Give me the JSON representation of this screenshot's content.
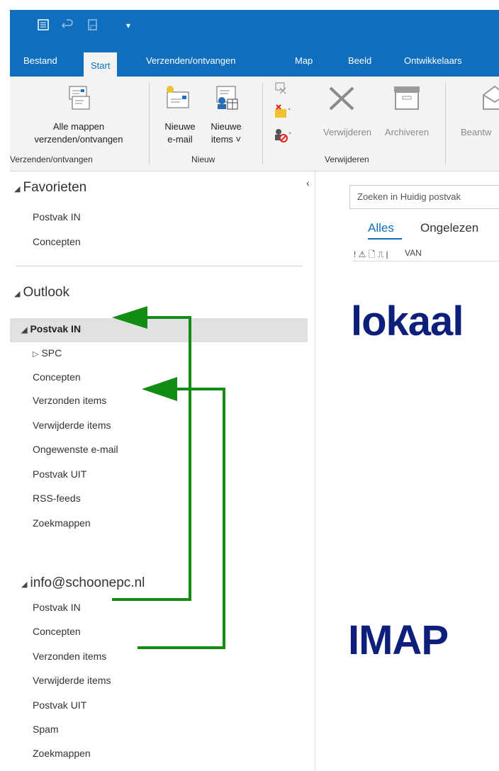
{
  "window": {
    "accent_color": "#106ebe",
    "quick_access_icons": [
      "mailbox-icon",
      "undo-icon",
      "new-document-icon",
      "customize-arrow-icon"
    ]
  },
  "tabs": [
    "Bestand",
    "Start",
    "Verzenden/ontvangen",
    "Map",
    "Beeld",
    "Ontwikkelaars"
  ],
  "ribbon": {
    "send_receive_all_line1": "Alle mappen",
    "send_receive_all_line2": "verzenden/ontvangen",
    "new_email_line1": "Nieuwe",
    "new_email_line2": "e-mail",
    "new_items_line1": "Nieuwe",
    "new_items_line2": "items ˅",
    "delete_label": "Verwijderen",
    "archive_label": "Archiveren",
    "reply_label": "Beantw",
    "group_send_receive": "Verzenden/ontvangen",
    "group_new": "Nieuw",
    "group_delete": "Verwijderen"
  },
  "folders": {
    "favorites_title": "Favorieten",
    "favorites": [
      "Postvak IN",
      "Concepten"
    ],
    "outlook_title": "Outlook",
    "outlook_inbox": "Postvak IN",
    "outlook_sub": "SPC",
    "outlook_items": [
      "Concepten",
      "Verzonden items",
      "Verwijderde items",
      "Ongewenste e-mail",
      "Postvak UIT",
      "RSS-feeds",
      "Zoekmappen"
    ],
    "imap_title": "info@schoonepc.nl",
    "imap_items": [
      "Postvak IN",
      "Concepten",
      "Verzonden items",
      "Verwijderde items",
      "Postvak UIT",
      "Spam",
      "Zoekmappen"
    ]
  },
  "mail_list": {
    "search_placeholder": "Zoeken in Huidig postvak",
    "filter_all": "Alles",
    "filter_unread": "Ongelezen",
    "column_from": "VAN",
    "column_icons": "! ⚠ 🗋 ⎍ |"
  },
  "annotations": {
    "local_label": "lokaal",
    "imap_label": "IMAP",
    "arrow_color": "#128c12",
    "label_color": "#0d1f7a"
  }
}
